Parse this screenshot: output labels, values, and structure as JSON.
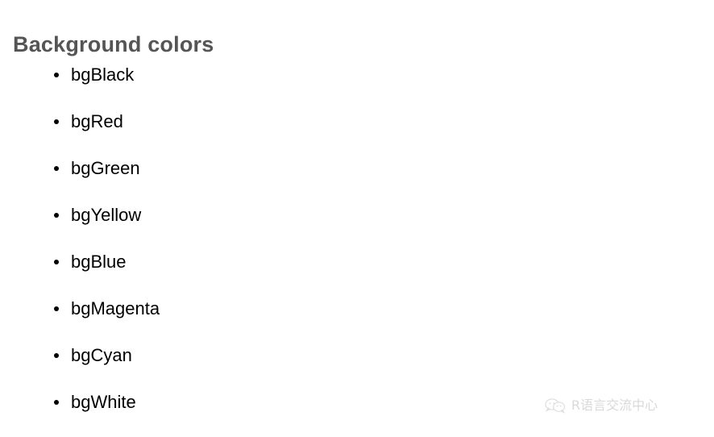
{
  "page": {
    "background_color": "#ffffff"
  },
  "heading": {
    "text": "Background colors",
    "color": "#555555"
  },
  "list": {
    "text_color": "#000000",
    "bullet_color": "#000000",
    "items": [
      {
        "label": "bgBlack"
      },
      {
        "label": "bgRed"
      },
      {
        "label": "bgGreen"
      },
      {
        "label": "bgYellow"
      },
      {
        "label": "bgBlue"
      },
      {
        "label": "bgMagenta"
      },
      {
        "label": "bgCyan"
      },
      {
        "label": "bgWhite"
      }
    ]
  },
  "watermark": {
    "icon": "wechat-bubbles-icon",
    "text": "R语言交流中心",
    "color": "#d9d9d9"
  }
}
